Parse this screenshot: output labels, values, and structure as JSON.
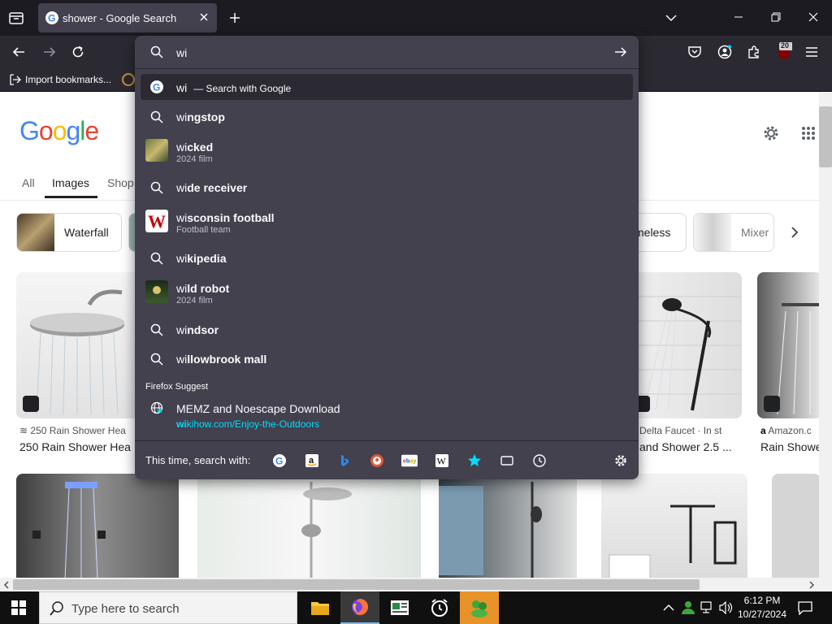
{
  "browser": {
    "tab_title": "shower - Google Search",
    "bookmark_import": "Import bookmarks...",
    "extension_badge": "20"
  },
  "urlbar": {
    "query": "wi",
    "heuristic": {
      "typed": "wi",
      "suffix": "— Search with Google"
    },
    "suggestions": [
      {
        "prefix": "wi",
        "rest": "ngstop",
        "sub": "",
        "icon": "search-icon"
      },
      {
        "prefix": "wi",
        "rest": "cked",
        "sub": "2024 film",
        "icon": "thumbnail"
      },
      {
        "prefix": "wi",
        "rest": "de receiver",
        "sub": "",
        "icon": "search-icon"
      },
      {
        "prefix": "wi",
        "rest": "sconsin football",
        "sub": "Football team",
        "icon": "thumbnail"
      },
      {
        "prefix": "wi",
        "rest": "kipedia",
        "sub": "",
        "icon": "search-icon"
      },
      {
        "prefix": "wi",
        "rest": "ld robot",
        "sub": "2024 film",
        "icon": "thumbnail"
      },
      {
        "prefix": "wi",
        "rest": "ndsor",
        "sub": "",
        "icon": "search-icon"
      },
      {
        "prefix": "wi",
        "rest": "llowbrook mall",
        "sub": "",
        "icon": "search-icon"
      }
    ],
    "group_label": "Firefox Suggest",
    "firefox_suggest": {
      "title": "MEMZ and Noescape Download",
      "url_prefix": "wi",
      "url_rest": "kihow.com/Enjoy-the-Outdoors"
    },
    "search_with_label": "This time, search with:"
  },
  "google": {
    "tabs": [
      "All",
      "Images",
      "Shop"
    ],
    "chips": [
      "Waterfall",
      "meless",
      "Mixer"
    ],
    "results": [
      {
        "source": "250 Rain Shower Hea",
        "title": "250 Rain Shower Hea"
      },
      {
        "source": "Delta Faucet · In st",
        "title": "and Shower 2.5 ..."
      },
      {
        "source": "Amazon.c",
        "title": "Rain Showe"
      }
    ]
  },
  "taskbar": {
    "search_placeholder": "Type here to search",
    "time": "6:12 PM",
    "date": "10/27/2024"
  },
  "colors": {
    "accent": "#00ddff",
    "link": "#00ddff",
    "dropdown_bg": "#42414d",
    "toolbar_bg": "#2b2a33"
  }
}
